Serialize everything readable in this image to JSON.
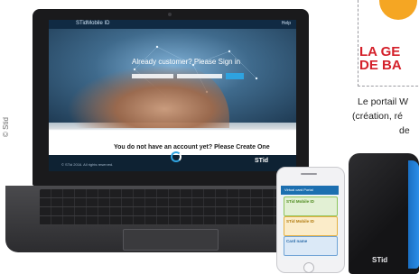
{
  "credit": "© Stid",
  "side_heading": [
    "LA GE",
    "DE BA"
  ],
  "side_body": [
    "Le portail W",
    "(création, ré",
    "de"
  ],
  "laptop_screen": {
    "app_title": "STidMobile ID",
    "top_right": "Help",
    "hero_text": "Already customer? Please Sign in",
    "create_account": "You do not have an account yet? Please Create One",
    "footer_copy": "© STid 2016. All rights reserved.",
    "footer_logo": "STid"
  },
  "phone_screen": {
    "header": "Virtual card Portal",
    "cards": [
      {
        "title": "STid Mobile ID",
        "color": "#8ec45a"
      },
      {
        "title": "STid Mobile ID",
        "color": "#e5b040"
      },
      {
        "title": "Card name",
        "color": "#6fa3d6"
      }
    ]
  },
  "reader_logo": "STid",
  "colors": {
    "accent": "#2ea3e0",
    "heading_red": "#d4202a",
    "orange": "#f5a623",
    "reader_blue": "#2b8ee8"
  }
}
